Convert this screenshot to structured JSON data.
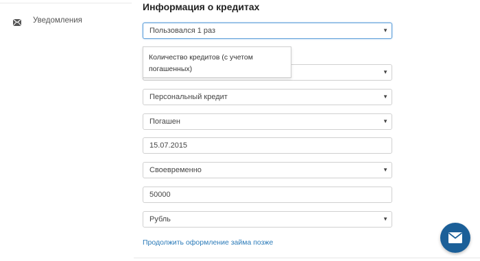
{
  "sidebar": {
    "items": [
      {
        "label": "Уведомления",
        "icon": "envelope-icon"
      }
    ]
  },
  "main": {
    "title": "Информация о кредитах",
    "fields": {
      "credit_usage": {
        "value": "Пользовался 1 раз",
        "type": "select"
      },
      "credit_count": {
        "value": "",
        "type": "select"
      },
      "credit_type": {
        "value": "Персональный кредит",
        "type": "select"
      },
      "credit_status": {
        "value": "Погашен",
        "type": "select"
      },
      "repayment_date": {
        "value": "15.07.2015",
        "type": "text"
      },
      "payment_discipline": {
        "value": "Своевременно",
        "type": "select"
      },
      "amount": {
        "value": "50000",
        "type": "text"
      },
      "currency": {
        "value": "Рубль",
        "type": "select"
      }
    },
    "tooltip": "Количество кредитов (с учетом погашенных)",
    "later_link": "Продолжить оформление займа позже"
  },
  "chat_button": {
    "icon": "envelope-icon"
  },
  "colors": {
    "accent": "#1b5f98",
    "link": "#2a7ab8",
    "focus": "#5b9dd9"
  }
}
